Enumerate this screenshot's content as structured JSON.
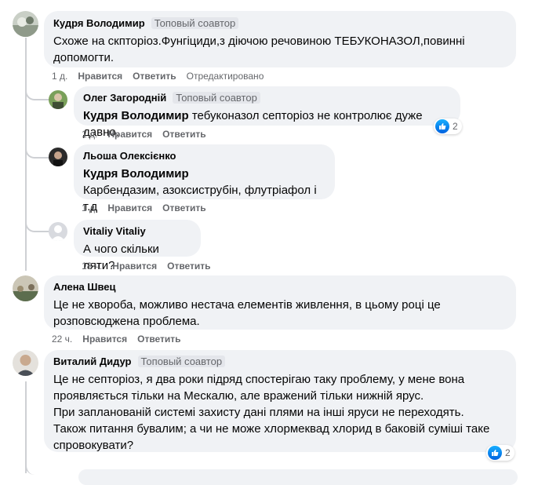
{
  "comments": [
    {
      "author": "Кудря Володимир",
      "badge": "Топовый соавтор",
      "lines": [
        "Схоже на скпторіоз.Фунгіциди,з діючою речовиною ТЕБУКОНАЗОЛ,повинні",
        "допомогти."
      ],
      "time": "1 д.",
      "like": "Нравится",
      "reply": "Ответить",
      "edited": "Отредактировано"
    },
    {
      "author": "Олег Загородній",
      "badge": "Топовый соавтор",
      "mention": "Кудря Володимир",
      "text": " тебуконазол септоріоз не контролює дуже давно.",
      "time": "1 д.",
      "like": "Нравится",
      "reply": "Ответить",
      "reactions": "2"
    },
    {
      "author": "Льоша Олексієнко",
      "mention": "Кудря Володимир",
      "text": "Карбендазим, азоксиструбін, флутріафол і т.д",
      "time": "1 д.",
      "like": "Нравится",
      "reply": "Ответить"
    },
    {
      "author": "Vitaliy Vitaliy",
      "text": "А чого скільки ляти?",
      "time": "18 ч.",
      "like": "Нравится",
      "reply": "Ответить"
    },
    {
      "author": "Алена Швец",
      "lines": [
        "Це не хвороба, можливо нестача елементів живлення, в цьому році це",
        "розповсюджена проблема."
      ],
      "time": "22 ч.",
      "like": "Нравится",
      "reply": "Ответить"
    },
    {
      "author": "Виталий Дидур",
      "badge": "Топовый соавтор",
      "lines": [
        "Це не септоріоз, я два роки підряд спостерігаю таку проблему, у мене вона",
        "проявляється тільки на Мескалю, але вражений тільки нижній ярус.",
        "При запланованій системі захисту дані плями на інші яруси не переходять.",
        "Також питання бувалим; а чи не може хлормеквад хлорид в баковій суміші таке",
        "спровокувати?"
      ],
      "reactions": "2"
    }
  ],
  "colors": {
    "bubble": "#f0f2f5",
    "meta": "#65676b",
    "thread": "#ced0d4",
    "like_blue": "#1877f2"
  }
}
